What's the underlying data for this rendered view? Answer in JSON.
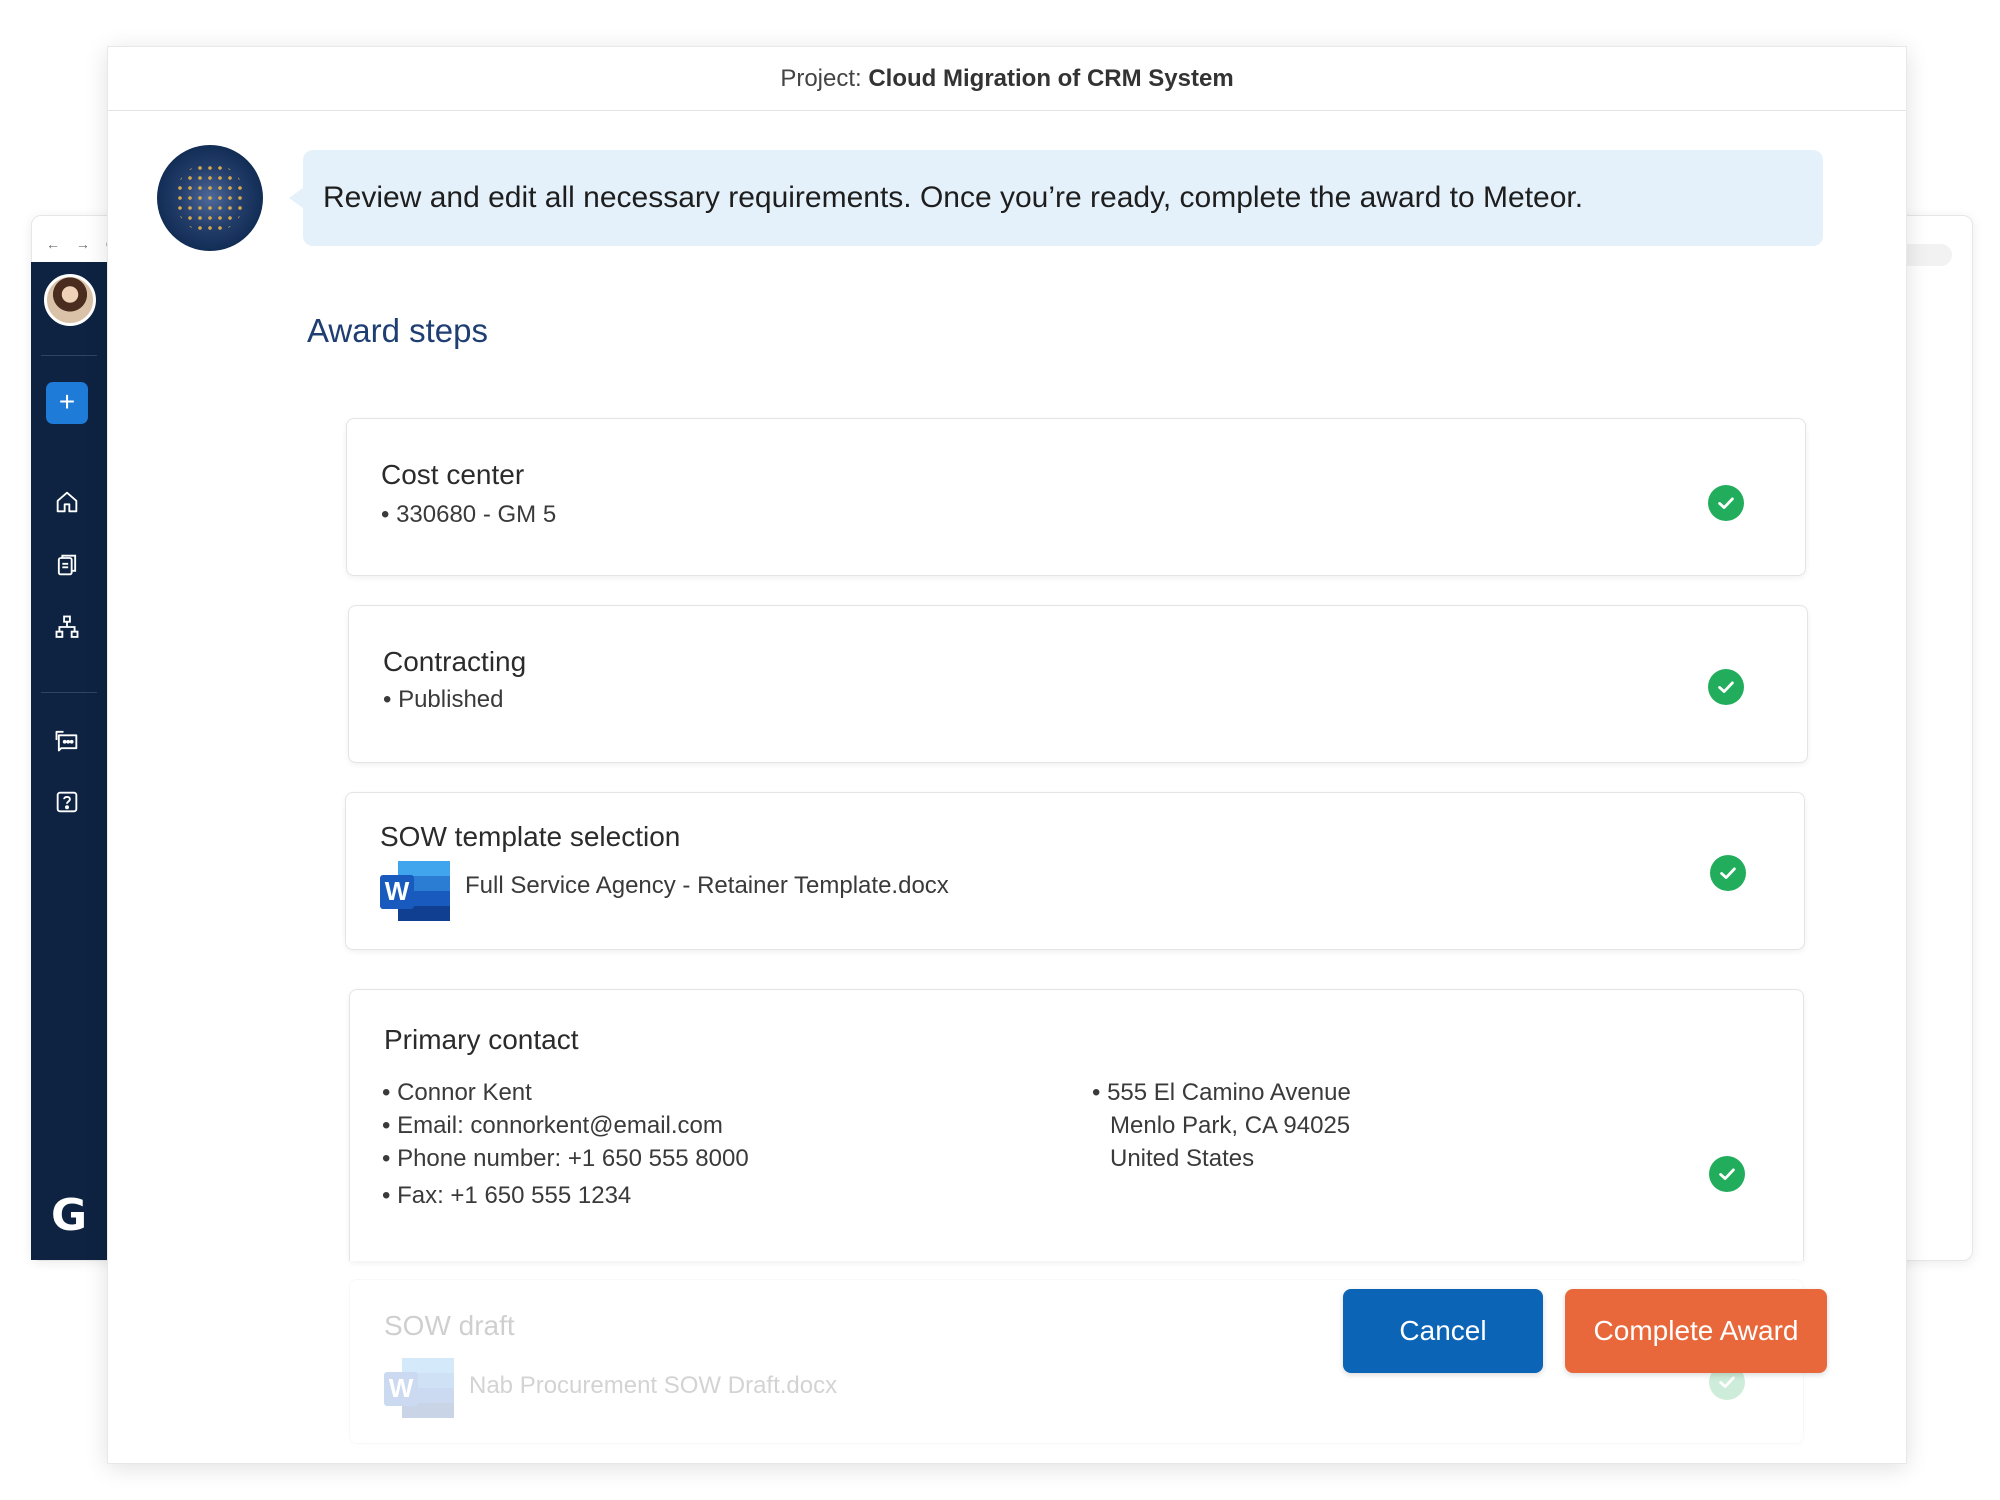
{
  "background_window": {
    "nav_controls": "← → C"
  },
  "sidebar": {
    "add_label": "+",
    "logo_text": "G"
  },
  "modal": {
    "project_prefix": "Project: ",
    "project_name": "Cloud Migration of CRM System"
  },
  "assistant": {
    "message": "Review and edit all necessary requirements. Once you’re ready, complete the award to Meteor."
  },
  "award_steps": {
    "title": "Award steps",
    "cards": {
      "cost_center": {
        "title": "Cost center",
        "line": "• 330680 - GM 5"
      },
      "contracting": {
        "title": "Contracting",
        "line": "• Published"
      },
      "sow_template": {
        "title": "SOW template selection",
        "file": "Full Service Agency - Retainer Template.docx",
        "file_icon_letter": "W"
      },
      "primary_contact": {
        "title": "Primary contact",
        "name": "• Connor Kent",
        "email": "• Email: connorkent@email.com",
        "phone": "• Phone number: +1 650 555 8000",
        "fax": "• Fax: +1 650 555 1234",
        "address_line1": "•  555 El Camino Avenue",
        "address_line2": "Menlo Park, CA 94025",
        "address_line3": "United States"
      },
      "sow_draft": {
        "title": "SOW draft",
        "file": "Nab Procurement SOW Draft.docx",
        "file_icon_letter": "W"
      }
    }
  },
  "actions": {
    "cancel": "Cancel",
    "complete": "Complete Award"
  },
  "colors": {
    "sidebar_bg": "#0d2341",
    "accent_blue": "#0b64b5",
    "accent_orange": "#e8683b",
    "success_green": "#22ad5c",
    "heading_blue": "#1f3f73",
    "bubble_bg": "#e4f1fa"
  },
  "icons": {
    "check": "check-circle-icon",
    "home": "home-icon",
    "documents": "documents-icon",
    "org": "org-chart-icon",
    "chat": "chat-icon",
    "help": "help-icon",
    "word": "word-file-icon"
  }
}
